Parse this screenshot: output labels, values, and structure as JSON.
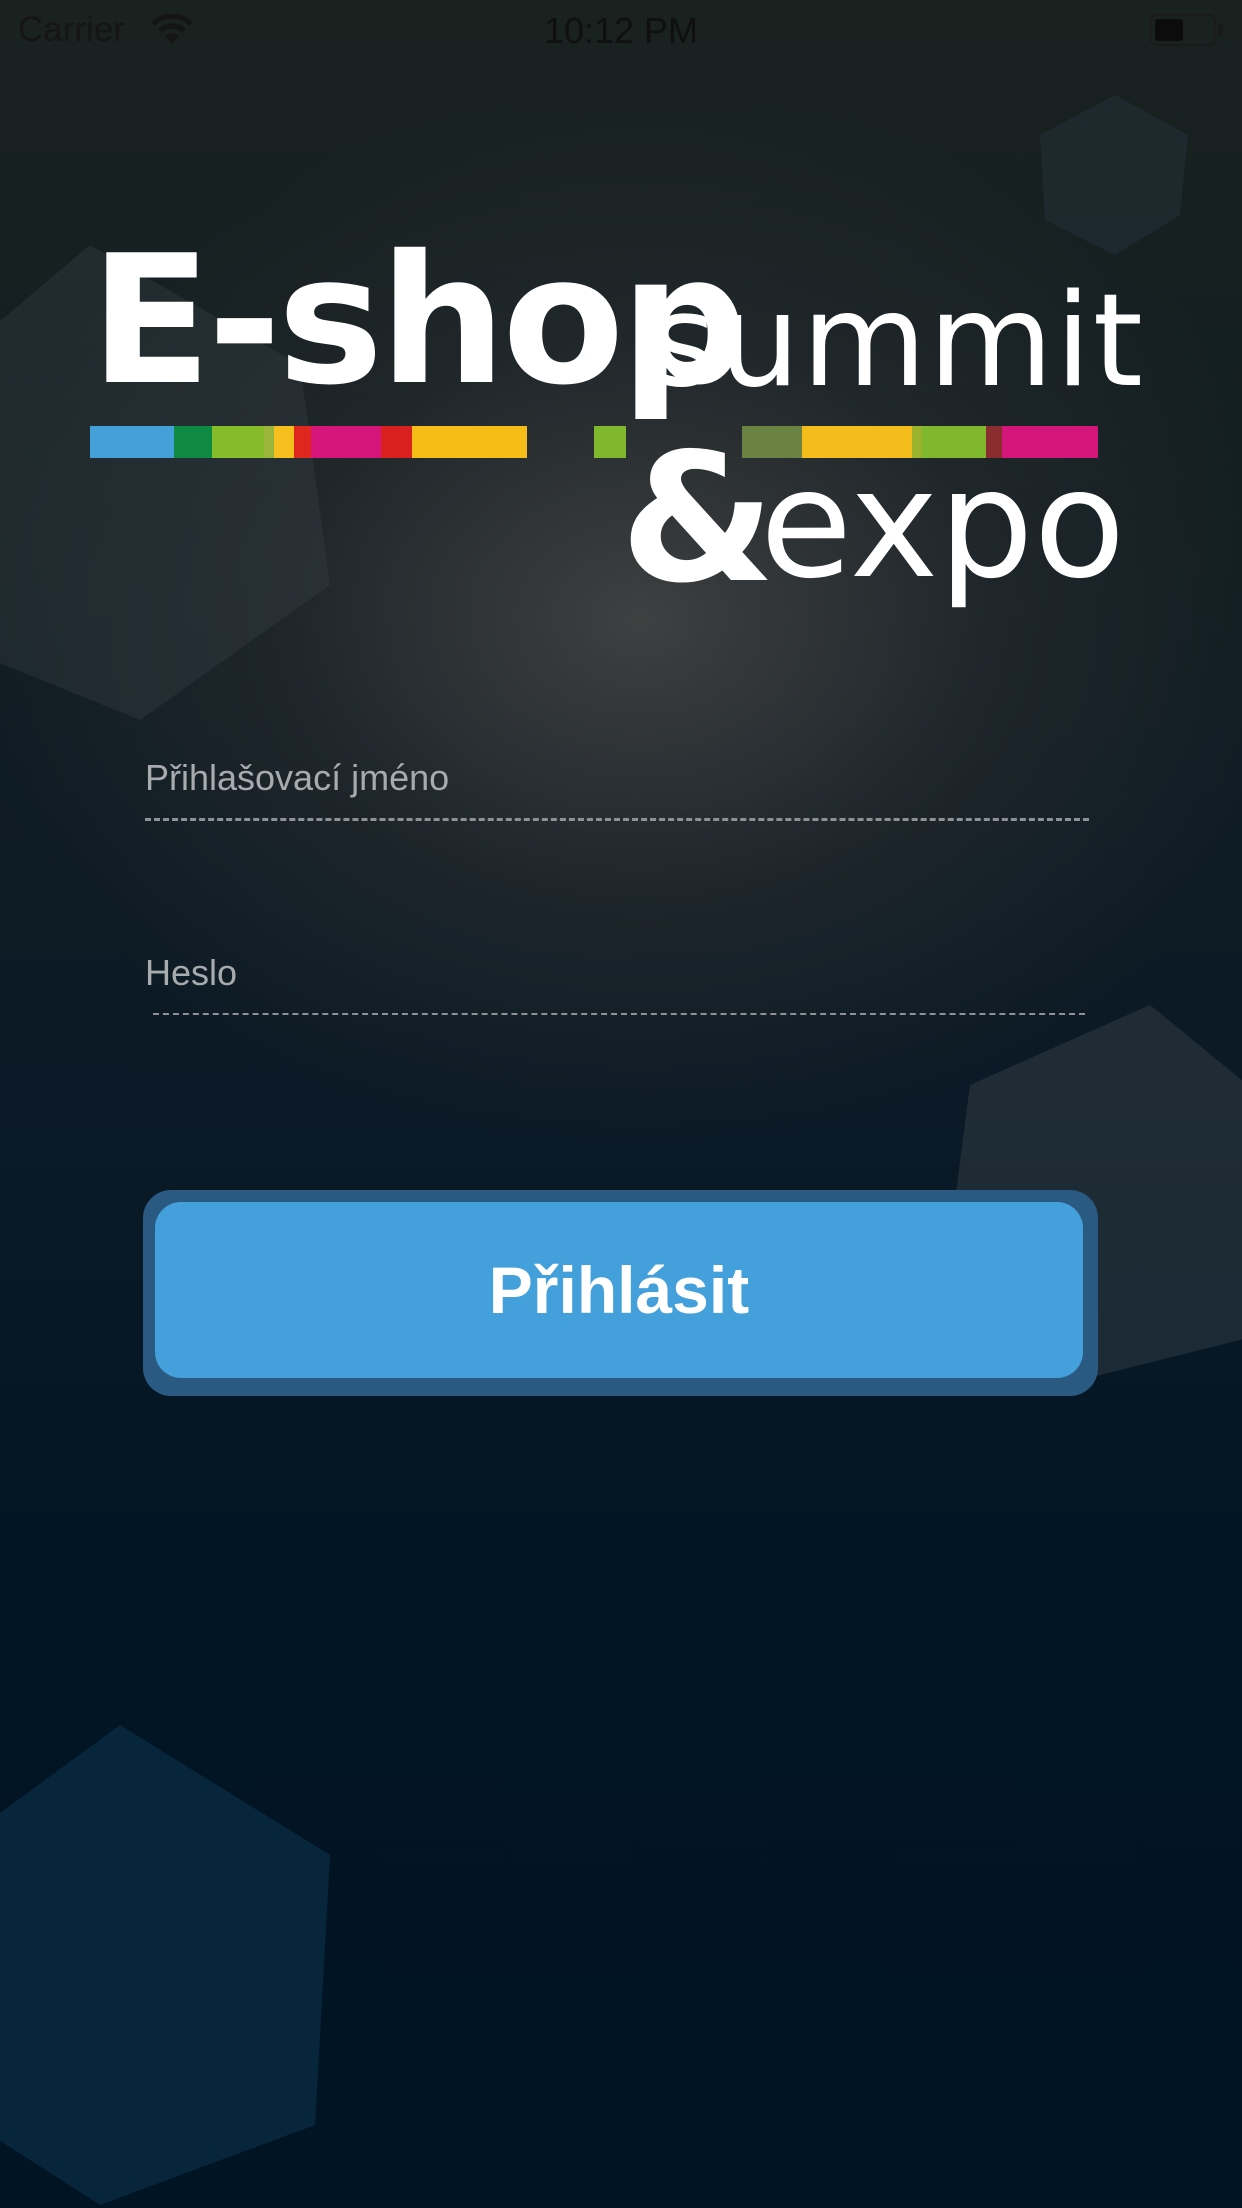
{
  "status_bar": {
    "carrier": "Carrier",
    "time": "10:12 PM"
  },
  "logo": {
    "eshop": "E-shop",
    "summit": "summit",
    "ampersand": "&",
    "expo": "expo",
    "stripe_colors_left": [
      "#44a0d8",
      "#0e8a43",
      "#86bb2a",
      "#f5bf1e",
      "#e0271f",
      "#d5157a",
      "#d8201e",
      "#f7bd17"
    ],
    "stripe_colors_right": [
      "#6a8342",
      "#f5bd1b",
      "#80b82d",
      "#8b2c2e",
      "#d4157a"
    ]
  },
  "form": {
    "username_placeholder": "Přihlašovací jméno",
    "username_value": "",
    "password_placeholder": "Heslo",
    "password_value": "",
    "login_label": "Přihlásit"
  },
  "colors": {
    "accent": "#43a0da",
    "accent_shadow": "#2a5a82",
    "background": "#011423"
  }
}
